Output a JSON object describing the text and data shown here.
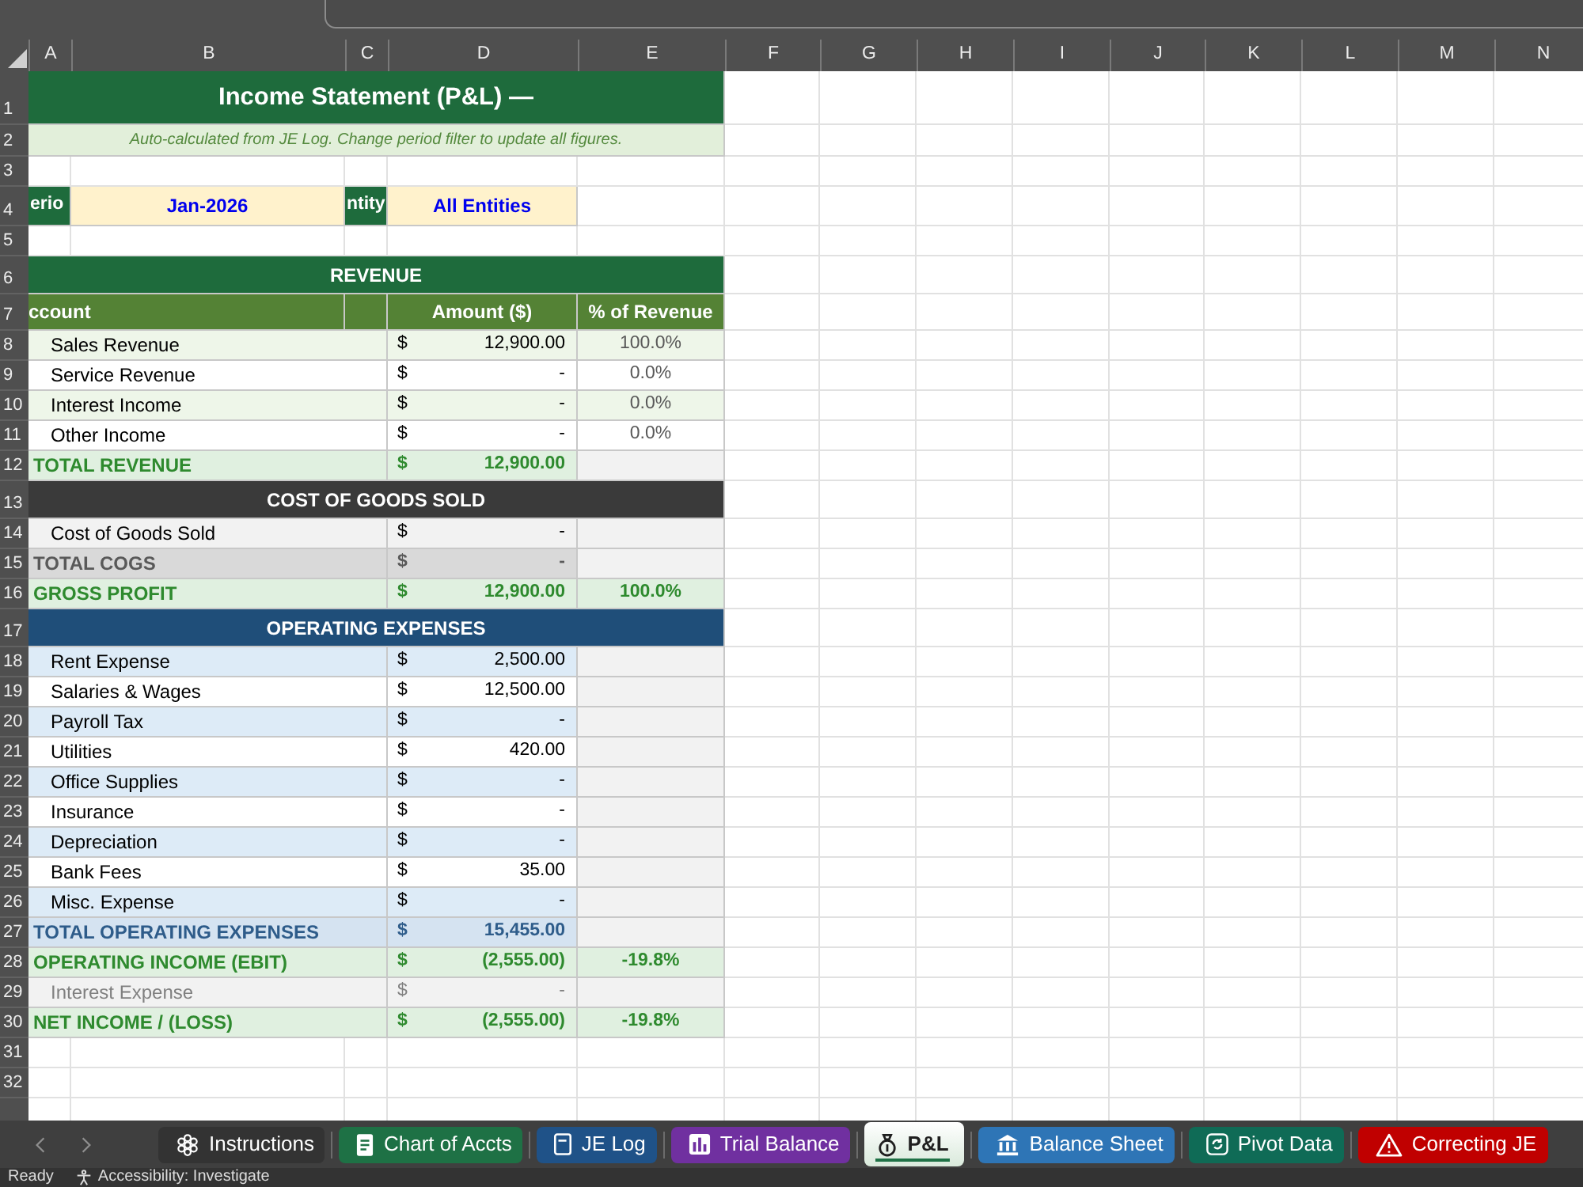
{
  "columns": [
    "A",
    "B",
    "C",
    "D",
    "E",
    "F",
    "G",
    "H",
    "I",
    "J",
    "K",
    "L",
    "M",
    "N"
  ],
  "rows": [
    {
      "number": "1",
      "kind": "title",
      "text": "Income Statement (P&L) —"
    },
    {
      "number": "2",
      "kind": "note",
      "text": "Auto-calculated from JE Log. Change period filter to update all figures."
    },
    {
      "number": "3",
      "kind": "blank"
    },
    {
      "number": "4",
      "kind": "filters",
      "filters": [
        {
          "label": "erio",
          "value": "Jan-2026"
        },
        {
          "label": "ntity",
          "value": "All Entities"
        }
      ]
    },
    {
      "number": "5",
      "kind": "blank"
    },
    {
      "number": "6",
      "kind": "section",
      "color": "#1e6b3c",
      "text": "REVENUE"
    },
    {
      "number": "7",
      "kind": "columns",
      "columns": [
        "ccount",
        "Amount ($)",
        "% of Revenue"
      ]
    },
    {
      "number": "8",
      "kind": "line",
      "color": "#eef6e9",
      "dimmed": false,
      "account": "Sales Revenue",
      "currency": "$",
      "amount": "12,900.00",
      "share": "100.0%"
    },
    {
      "number": "9",
      "kind": "line",
      "color": "#ffffff",
      "dimmed": false,
      "account": "Service Revenue",
      "currency": "$",
      "amount": "-",
      "share": "0.0%"
    },
    {
      "number": "10",
      "kind": "line",
      "color": "#eef6e9",
      "dimmed": false,
      "account": "Interest Income",
      "currency": "$",
      "amount": "-",
      "share": "0.0%"
    },
    {
      "number": "11",
      "kind": "line",
      "color": "#ffffff",
      "dimmed": false,
      "account": "Other Income",
      "currency": "$",
      "amount": "-",
      "share": "0.0%"
    },
    {
      "number": "12",
      "kind": "total",
      "color": "#e0f0e0",
      "account": "TOTAL REVENUE",
      "currency": "$",
      "amount": "12,900.00"
    },
    {
      "number": "13",
      "kind": "section",
      "color": "#3a3a3a",
      "text": "COST OF GOODS SOLD"
    },
    {
      "number": "14",
      "kind": "line",
      "color": "#f2f2f2",
      "dimmed": false,
      "account": "Cost of Goods Sold",
      "currency": "$",
      "amount": "-"
    },
    {
      "number": "15",
      "kind": "total",
      "color": "#d9d9d9",
      "account": "TOTAL COGS",
      "currency": "$",
      "amount": "-"
    },
    {
      "number": "16",
      "kind": "total",
      "color": "#e0f0e0",
      "account": "GROSS PROFIT",
      "currency": "$",
      "amount": "12,900.00",
      "share": "100.0%"
    },
    {
      "number": "17",
      "kind": "section",
      "color": "#1f4e79",
      "text": "OPERATING EXPENSES"
    },
    {
      "number": "18",
      "kind": "line",
      "color": "#ddebf7",
      "dimmed": false,
      "account": "Rent Expense",
      "currency": "$",
      "amount": "2,500.00"
    },
    {
      "number": "19",
      "kind": "line",
      "color": "#ffffff",
      "dimmed": false,
      "account": "Salaries & Wages",
      "currency": "$",
      "amount": "12,500.00"
    },
    {
      "number": "20",
      "kind": "line",
      "color": "#ddebf7",
      "dimmed": false,
      "account": "Payroll Tax",
      "currency": "$",
      "amount": "-"
    },
    {
      "number": "21",
      "kind": "line",
      "color": "#ffffff",
      "dimmed": false,
      "account": "Utilities",
      "currency": "$",
      "amount": "420.00"
    },
    {
      "number": "22",
      "kind": "line",
      "color": "#ddebf7",
      "dimmed": false,
      "account": "Office Supplies",
      "currency": "$",
      "amount": "-"
    },
    {
      "number": "23",
      "kind": "line",
      "color": "#ffffff",
      "dimmed": false,
      "account": "Insurance",
      "currency": "$",
      "amount": "-"
    },
    {
      "number": "24",
      "kind": "line",
      "color": "#ddebf7",
      "dimmed": false,
      "account": "Depreciation",
      "currency": "$",
      "amount": "-"
    },
    {
      "number": "25",
      "kind": "line",
      "color": "#ffffff",
      "dimmed": false,
      "account": "Bank Fees",
      "currency": "$",
      "amount": "35.00"
    },
    {
      "number": "26",
      "kind": "line",
      "color": "#ddebf7",
      "dimmed": false,
      "account": "Misc. Expense",
      "currency": "$",
      "amount": "-"
    },
    {
      "number": "27",
      "kind": "total",
      "color": "#d5e3f1",
      "account": "TOTAL OPERATING EXPENSES",
      "currency": "$",
      "amount": "15,455.00"
    },
    {
      "number": "28",
      "kind": "total",
      "color": "#e0f0e0",
      "account": "OPERATING INCOME (EBIT)",
      "currency": "$",
      "amount": "(2,555.00)",
      "share": "-19.8%"
    },
    {
      "number": "29",
      "kind": "line",
      "color": "#f2f2f2",
      "dimmed": true,
      "account": "Interest Expense",
      "currency": "$",
      "amount": "-"
    },
    {
      "number": "30",
      "kind": "total",
      "color": "#e0f0e0",
      "account": "NET INCOME / (LOSS)",
      "currency": "$",
      "amount": "(2,555.00)",
      "share": "-19.8%"
    },
    {
      "number": "31",
      "kind": "blank"
    },
    {
      "number": "32",
      "kind": "blank"
    },
    {
      "kind": "blank"
    }
  ],
  "sheet_tabs": [
    {
      "label": "Instructions",
      "color": "#333333",
      "selected": false
    },
    {
      "label": "Chart of Accts",
      "color": "#1e7145",
      "selected": false
    },
    {
      "label": "JE Log",
      "color": "#1f5288",
      "selected": false
    },
    {
      "label": "Trial Balance",
      "color": "#7030a0",
      "selected": false
    },
    {
      "label": "P&L",
      "color": "#1e7145",
      "selected": true
    },
    {
      "label": "Balance Sheet",
      "color": "#2e75b6",
      "selected": false
    },
    {
      "label": "Pivot Data",
      "color": "#0f6b56",
      "selected": false
    },
    {
      "label": "Correcting JE",
      "color": "#c00000",
      "selected": false
    }
  ],
  "status_bar": {
    "mode": "Ready",
    "accessibility": "Accessibility: Investigate"
  }
}
